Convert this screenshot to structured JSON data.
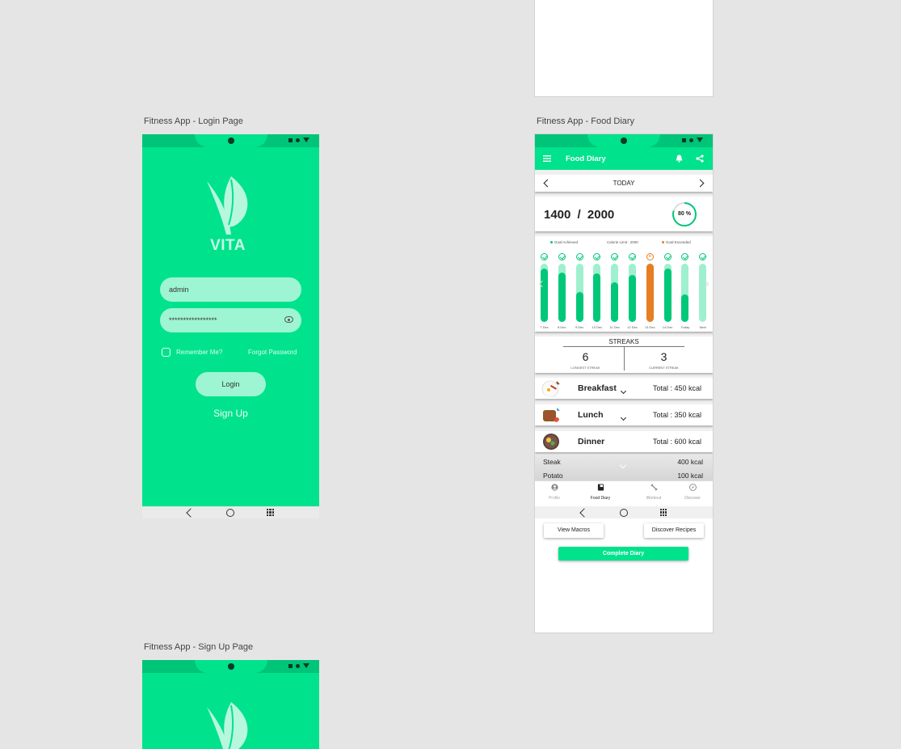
{
  "canvas": {
    "labels": {
      "login": "Fitness App - Login Page",
      "food_diary": "Fitness App - Food Diary",
      "signup": "Fitness App - Sign Up Page"
    }
  },
  "login": {
    "brand": "VITA",
    "username_value": "admin",
    "password_value": "*****************",
    "remember_label": "Remember Me?",
    "forgot_label": "Forgot Password",
    "login_button": "Login",
    "signup_link": "Sign Up"
  },
  "food_diary": {
    "title": "Food Diary",
    "date_label": "TODAY",
    "calories_consumed": "1400",
    "calories_separator": "/",
    "calories_goal": "2000",
    "percent": "80 %",
    "percent_value": 0.8,
    "legend": {
      "achieved": "Goal Achieved",
      "limit": "Calorie Limit : 2000",
      "exceeded": "Goal Exceeded"
    },
    "days": [
      {
        "label": "7 Dec",
        "fill": 0.92,
        "status": "achieved"
      },
      {
        "label": "8 Dec",
        "fill": 0.85,
        "status": "achieved"
      },
      {
        "label": "9 Dec",
        "fill": 0.52,
        "status": "achieved"
      },
      {
        "label": "10 Dec",
        "fill": 0.83,
        "status": "achieved"
      },
      {
        "label": "11 Dec",
        "fill": 0.68,
        "status": "achieved"
      },
      {
        "label": "12 Dec",
        "fill": 0.81,
        "status": "achieved"
      },
      {
        "label": "13 Dec",
        "fill": 1.0,
        "status": "exceeded"
      },
      {
        "label": "14 Dec",
        "fill": 0.92,
        "status": "achieved"
      },
      {
        "label": "Today",
        "fill": 0.47,
        "status": "achieved"
      },
      {
        "label": "Next",
        "fill": 0.0,
        "status": "achieved"
      }
    ],
    "streaks": {
      "title": "STREAKS",
      "longest_value": "6",
      "longest_label": "LONGEST STREAK",
      "current_value": "3",
      "current_label": "CURRENT STREAK"
    },
    "meals": [
      {
        "name": "Breakfast",
        "total": "Total : 450 kcal"
      },
      {
        "name": "Lunch",
        "total": "Total : 350 kcal"
      },
      {
        "name": "Dinner",
        "total": "Total : 600 kcal"
      }
    ],
    "dinner_items": [
      {
        "name": "Steak",
        "kcal": "400 kcal"
      },
      {
        "name": "Potato",
        "kcal": "100 kcal"
      }
    ],
    "bottom_nav": [
      "Profile",
      "Food Diary",
      "Workout",
      "Discover"
    ],
    "buttons": {
      "view_macros": "View Macros",
      "discover_recipes": "Discover Recipes",
      "complete_diary": "Complete Diary"
    }
  },
  "colors": {
    "brand_green": "#00e28c",
    "dark_green": "#00c878",
    "light_green": "#9ef5d3",
    "exceeded": "#e67e22"
  }
}
